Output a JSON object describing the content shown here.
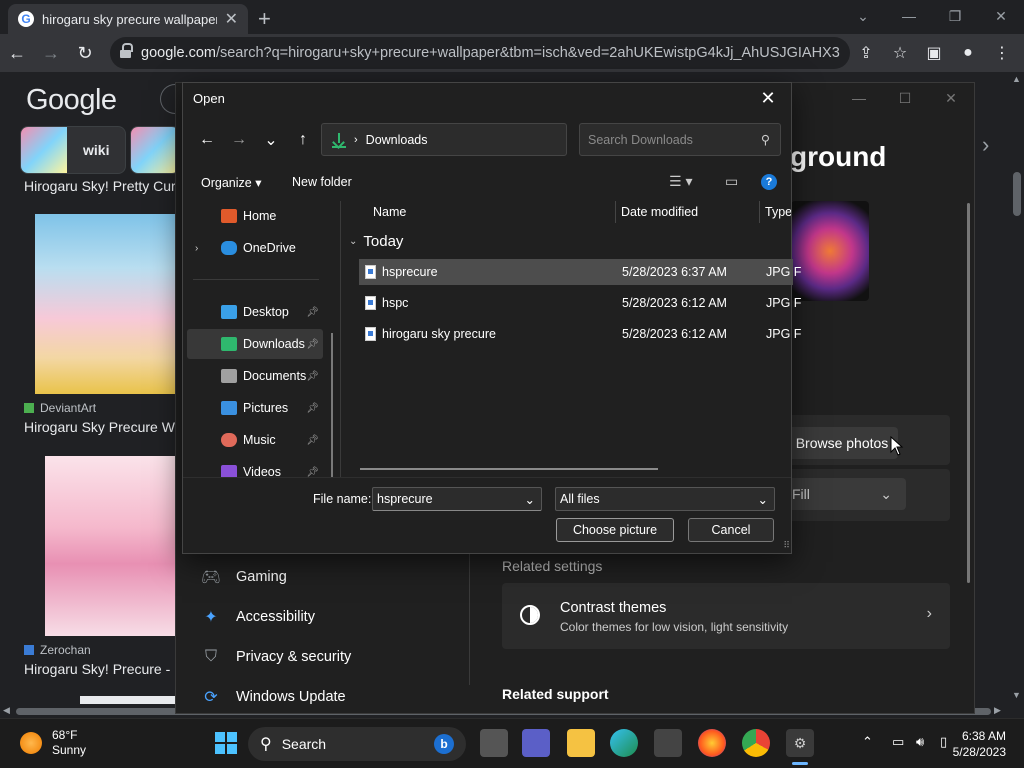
{
  "browser": {
    "tab_title": "hirogaru sky precure wallpaper -",
    "tab_favicon": "G",
    "url_host": "google.com",
    "url_rest": "/search?q=hirogaru+sky+precure+wallpaper&tbm=isch&ved=2ahUKEwistpG4kJj_AhUSJGIAHX3dA6..."
  },
  "google": {
    "logo": "Google",
    "chip_wiki": "wiki",
    "results": [
      {
        "source": "DeviantArt",
        "title": "Hirogaru Sky Precure W"
      },
      {
        "source": "Zerochan",
        "title": "Hirogaru Sky! Precure -"
      }
    ],
    "top_caption": "Hirogaru Sky! Pretty Cur"
  },
  "settings": {
    "heading_partial": "ground",
    "browse_label": "Browse photos",
    "fit_value": "Fill",
    "nav": [
      {
        "label": "Gaming",
        "icon": "gaming-icon"
      },
      {
        "label": "Accessibility",
        "icon": "accessibility-icon"
      },
      {
        "label": "Privacy & security",
        "icon": "shield-icon"
      },
      {
        "label": "Windows Update",
        "icon": "update-icon"
      }
    ],
    "related_settings": "Related settings",
    "contrast_title": "Contrast themes",
    "contrast_sub": "Color themes for low vision, light sensitivity",
    "related_support": "Related support"
  },
  "dialog": {
    "title": "Open",
    "breadcrumb": "Downloads",
    "search_placeholder": "Search Downloads",
    "organize": "Organize",
    "new_folder": "New folder",
    "nav_items": [
      {
        "label": "Home",
        "color": "#e05a2b"
      },
      {
        "label": "OneDrive",
        "color": "#2a8ee0"
      },
      {
        "label": "Desktop",
        "color": "#3aa0e8"
      },
      {
        "label": "Downloads",
        "color": "#2fb86e"
      },
      {
        "label": "Documents",
        "color": "#a0a0a0"
      },
      {
        "label": "Pictures",
        "color": "#3a90e0"
      },
      {
        "label": "Music",
        "color": "#e06a5a"
      },
      {
        "label": "Videos",
        "color": "#8a50d8"
      }
    ],
    "columns": {
      "name": "Name",
      "date": "Date modified",
      "type": "Type"
    },
    "group": "Today",
    "files": [
      {
        "name": "hsprecure",
        "date": "5/28/2023 6:37 AM",
        "type": "JPG F"
      },
      {
        "name": "hspc",
        "date": "5/28/2023 6:12 AM",
        "type": "JPG F"
      },
      {
        "name": "hirogaru sky precure",
        "date": "5/28/2023 6:12 AM",
        "type": "JPG F"
      }
    ],
    "file_name_label": "File name:",
    "file_name_value": "hsprecure",
    "file_type_value": "All files",
    "choose_label": "Choose picture",
    "cancel_label": "Cancel"
  },
  "taskbar": {
    "temp": "68°F",
    "condition": "Sunny",
    "search": "Search",
    "time": "6:38 AM",
    "date": "5/28/2023"
  }
}
